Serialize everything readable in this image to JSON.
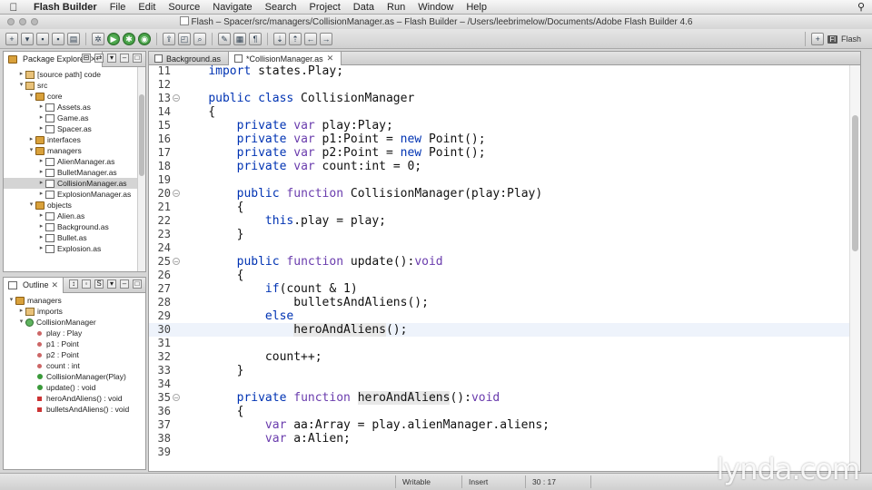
{
  "menubar": {
    "app_name": "Flash Builder",
    "items": [
      "File",
      "Edit",
      "Source",
      "Navigate",
      "Search",
      "Project",
      "Data",
      "Run",
      "Window",
      "Help"
    ]
  },
  "window": {
    "title": "Flash – Spacer/src/managers/CollisionManager.as – Flash Builder – /Users/leebrimelow/Documents/Adobe Flash Builder 4.6"
  },
  "perspective": {
    "label": "Flash",
    "badge": "Fl"
  },
  "package_explorer": {
    "tab_label": "Package Explorer",
    "tree": [
      {
        "label": "[source path] code",
        "depth": 1,
        "icon": "source-folder-icon",
        "expanded": false
      },
      {
        "label": "src",
        "depth": 1,
        "icon": "source-folder-icon",
        "expanded": true
      },
      {
        "label": "core",
        "depth": 2,
        "icon": "package-icon",
        "expanded": true
      },
      {
        "label": "Assets.as",
        "depth": 3,
        "icon": "as-file-icon",
        "expanded": false
      },
      {
        "label": "Game.as",
        "depth": 3,
        "icon": "as-file-icon",
        "expanded": false
      },
      {
        "label": "Spacer.as",
        "depth": 3,
        "icon": "as-file-icon",
        "expanded": false
      },
      {
        "label": "interfaces",
        "depth": 2,
        "icon": "package-icon",
        "expanded": false
      },
      {
        "label": "managers",
        "depth": 2,
        "icon": "package-icon",
        "expanded": true
      },
      {
        "label": "AlienManager.as",
        "depth": 3,
        "icon": "as-file-icon",
        "expanded": false
      },
      {
        "label": "BulletManager.as",
        "depth": 3,
        "icon": "as-file-icon",
        "expanded": false
      },
      {
        "label": "CollisionManager.as",
        "depth": 3,
        "icon": "as-file-icon",
        "expanded": false,
        "selected": true
      },
      {
        "label": "ExplosionManager.as",
        "depth": 3,
        "icon": "as-file-icon",
        "expanded": false
      },
      {
        "label": "objects",
        "depth": 2,
        "icon": "package-icon",
        "expanded": true
      },
      {
        "label": "Alien.as",
        "depth": 3,
        "icon": "as-file-icon",
        "expanded": false
      },
      {
        "label": "Background.as",
        "depth": 3,
        "icon": "as-file-icon",
        "expanded": false
      },
      {
        "label": "Bullet.as",
        "depth": 3,
        "icon": "as-file-icon",
        "expanded": false
      },
      {
        "label": "Explosion.as",
        "depth": 3,
        "icon": "as-file-icon",
        "expanded": false
      }
    ]
  },
  "outline": {
    "tab_label": "Outline",
    "tree": [
      {
        "label": "managers",
        "depth": 0,
        "icon": "package-icon",
        "twisty": "open"
      },
      {
        "label": "imports",
        "depth": 1,
        "icon": "imports-icon",
        "twisty": "closed"
      },
      {
        "label": "CollisionManager",
        "depth": 1,
        "icon": "class-icon",
        "twisty": "open"
      },
      {
        "label": "play : Play",
        "depth": 2,
        "icon": "private-var-icon",
        "twisty": ""
      },
      {
        "label": "p1 : Point",
        "depth": 2,
        "icon": "private-var-icon",
        "twisty": ""
      },
      {
        "label": "p2 : Point",
        "depth": 2,
        "icon": "private-var-icon",
        "twisty": ""
      },
      {
        "label": "count : int",
        "depth": 2,
        "icon": "private-var-icon",
        "twisty": ""
      },
      {
        "label": "CollisionManager(Play)",
        "depth": 2,
        "icon": "constructor-icon",
        "twisty": ""
      },
      {
        "label": "update() : void",
        "depth": 2,
        "icon": "public-method-icon",
        "twisty": ""
      },
      {
        "label": "heroAndAliens() : void",
        "depth": 2,
        "icon": "private-method-icon",
        "twisty": ""
      },
      {
        "label": "bulletsAndAliens() : void",
        "depth": 2,
        "icon": "private-method-icon",
        "twisty": ""
      }
    ]
  },
  "editor": {
    "tabs": [
      {
        "label": "Background.as",
        "active": false
      },
      {
        "label": "*CollisionManager.as",
        "active": true
      }
    ],
    "current_line": 30,
    "lines": [
      {
        "n": "11",
        "fold": "",
        "segs": [
          {
            "t": "    "
          },
          {
            "t": "import",
            "k": "kw"
          },
          {
            "t": " states.Play;"
          }
        ]
      },
      {
        "n": "12",
        "fold": "",
        "segs": []
      },
      {
        "n": "13",
        "fold": "⊖",
        "segs": [
          {
            "t": "    "
          },
          {
            "t": "public class",
            "k": "kw"
          },
          {
            "t": " CollisionManager"
          }
        ]
      },
      {
        "n": "14",
        "fold": "",
        "segs": [
          {
            "t": "    {"
          }
        ]
      },
      {
        "n": "15",
        "fold": "",
        "segs": [
          {
            "t": "        "
          },
          {
            "t": "private",
            "k": "kw"
          },
          {
            "t": " "
          },
          {
            "t": "var",
            "k": "kb"
          },
          {
            "t": " play:Play;"
          }
        ]
      },
      {
        "n": "16",
        "fold": "",
        "segs": [
          {
            "t": "        "
          },
          {
            "t": "private",
            "k": "kw"
          },
          {
            "t": " "
          },
          {
            "t": "var",
            "k": "kb"
          },
          {
            "t": " p1:Point = "
          },
          {
            "t": "new",
            "k": "kw"
          },
          {
            "t": " Point();"
          }
        ]
      },
      {
        "n": "17",
        "fold": "",
        "segs": [
          {
            "t": "        "
          },
          {
            "t": "private",
            "k": "kw"
          },
          {
            "t": " "
          },
          {
            "t": "var",
            "k": "kb"
          },
          {
            "t": " p2:Point = "
          },
          {
            "t": "new",
            "k": "kw"
          },
          {
            "t": " Point();"
          }
        ]
      },
      {
        "n": "18",
        "fold": "",
        "segs": [
          {
            "t": "        "
          },
          {
            "t": "private",
            "k": "kw"
          },
          {
            "t": " "
          },
          {
            "t": "var",
            "k": "kb"
          },
          {
            "t": " count:int = 0;"
          }
        ]
      },
      {
        "n": "19",
        "fold": "",
        "segs": []
      },
      {
        "n": "20",
        "fold": "⊖",
        "segs": [
          {
            "t": "        "
          },
          {
            "t": "public",
            "k": "kw"
          },
          {
            "t": " "
          },
          {
            "t": "function",
            "k": "kb"
          },
          {
            "t": " CollisionManager(play:Play)"
          }
        ]
      },
      {
        "n": "21",
        "fold": "",
        "segs": [
          {
            "t": "        {"
          }
        ]
      },
      {
        "n": "22",
        "fold": "",
        "segs": [
          {
            "t": "            "
          },
          {
            "t": "this",
            "k": "kw"
          },
          {
            "t": ".play = play;"
          }
        ]
      },
      {
        "n": "23",
        "fold": "",
        "segs": [
          {
            "t": "        }"
          }
        ]
      },
      {
        "n": "24",
        "fold": "",
        "segs": []
      },
      {
        "n": "25",
        "fold": "⊖",
        "segs": [
          {
            "t": "        "
          },
          {
            "t": "public",
            "k": "kw"
          },
          {
            "t": " "
          },
          {
            "t": "function",
            "k": "kb"
          },
          {
            "t": " update():"
          },
          {
            "t": "void",
            "k": "kb"
          }
        ]
      },
      {
        "n": "26",
        "fold": "",
        "segs": [
          {
            "t": "        {"
          }
        ]
      },
      {
        "n": "27",
        "fold": "",
        "segs": [
          {
            "t": "            "
          },
          {
            "t": "if",
            "k": "kw"
          },
          {
            "t": "(count & 1)"
          }
        ]
      },
      {
        "n": "28",
        "fold": "",
        "segs": [
          {
            "t": "                bulletsAndAliens();"
          }
        ]
      },
      {
        "n": "29",
        "fold": "",
        "segs": [
          {
            "t": "            "
          },
          {
            "t": "else",
            "k": "kw"
          }
        ]
      },
      {
        "n": "30",
        "fold": "",
        "segs": [
          {
            "t": "                "
          },
          {
            "t": "heroAndAliens",
            "k": "hl"
          },
          {
            "t": "();"
          }
        ]
      },
      {
        "n": "31",
        "fold": "",
        "segs": []
      },
      {
        "n": "32",
        "fold": "",
        "segs": [
          {
            "t": "            count++;"
          }
        ]
      },
      {
        "n": "33",
        "fold": "",
        "segs": [
          {
            "t": "        }"
          }
        ]
      },
      {
        "n": "34",
        "fold": "",
        "segs": []
      },
      {
        "n": "35",
        "fold": "⊖",
        "segs": [
          {
            "t": "        "
          },
          {
            "t": "private",
            "k": "kw"
          },
          {
            "t": " "
          },
          {
            "t": "function",
            "k": "kb"
          },
          {
            "t": " "
          },
          {
            "t": "heroAndAliens",
            "k": "hl"
          },
          {
            "t": "():"
          },
          {
            "t": "void",
            "k": "kb"
          }
        ]
      },
      {
        "n": "36",
        "fold": "",
        "segs": [
          {
            "t": "        {"
          }
        ]
      },
      {
        "n": "37",
        "fold": "",
        "segs": [
          {
            "t": "            "
          },
          {
            "t": "var",
            "k": "kb"
          },
          {
            "t": " aa:Array = play.alienManager.aliens;"
          }
        ]
      },
      {
        "n": "38",
        "fold": "",
        "segs": [
          {
            "t": "            "
          },
          {
            "t": "var",
            "k": "kb"
          },
          {
            "t": " a:Alien;"
          }
        ]
      },
      {
        "n": "39",
        "fold": "",
        "segs": []
      }
    ]
  },
  "status": {
    "mode": "Writable",
    "insert": "Insert",
    "position": "30 : 17"
  },
  "watermark": "lynda.com"
}
